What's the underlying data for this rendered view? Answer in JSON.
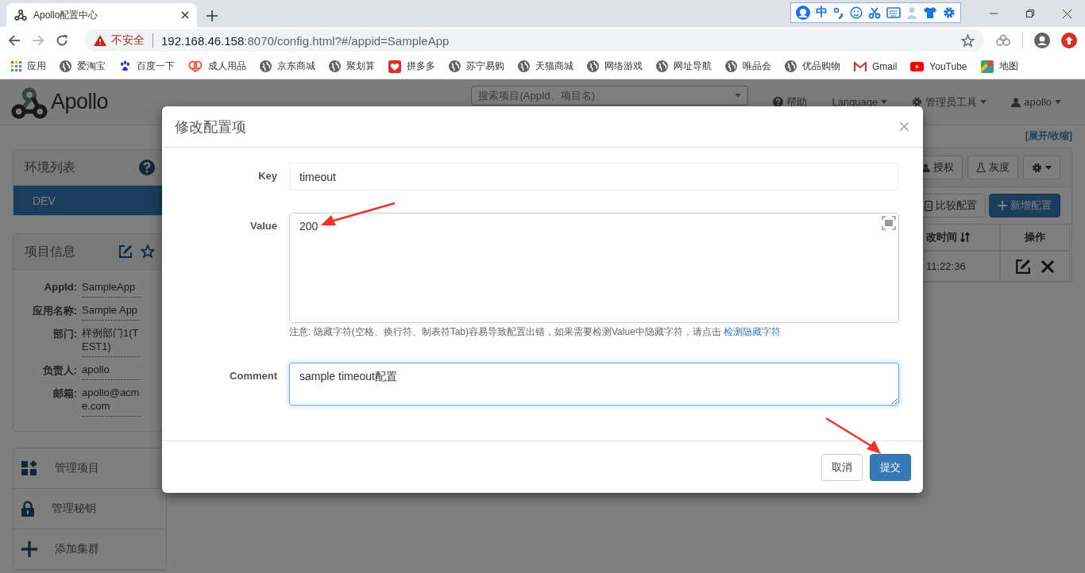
{
  "browser": {
    "tabs": [
      {
        "title": "Apollo配置中心",
        "selected": true
      }
    ],
    "ime_toolbar": {
      "mode": "中"
    },
    "address": {
      "security": "不安全",
      "host": "192.168.46.158",
      "path": ":8070/config.html?#/appid=SampleApp"
    },
    "bookmarks": [
      {
        "label": "应用",
        "kind": "apps"
      },
      {
        "label": "爱淘宝",
        "kind": "globe"
      },
      {
        "label": "百度一下",
        "kind": "paw"
      },
      {
        "label": "成人用品",
        "kind": "heart"
      },
      {
        "label": "京东商城",
        "kind": "globe"
      },
      {
        "label": "聚划算",
        "kind": "globe"
      },
      {
        "label": "拼多多",
        "kind": "gift"
      },
      {
        "label": "苏宁易购",
        "kind": "globe"
      },
      {
        "label": "天猫商城",
        "kind": "globe"
      },
      {
        "label": "网络游戏",
        "kind": "globe"
      },
      {
        "label": "网址导航",
        "kind": "globe"
      },
      {
        "label": "唯品会",
        "kind": "globe"
      },
      {
        "label": "优品购物",
        "kind": "globe"
      },
      {
        "label": "Gmail",
        "kind": "mail"
      },
      {
        "label": "YouTube",
        "kind": "video"
      },
      {
        "label": "地图",
        "kind": "map"
      }
    ]
  },
  "navbar": {
    "brand": "Apollo",
    "search": {
      "placeholder": "搜索项目(AppId、项目名)"
    },
    "links": [
      {
        "label": "帮助",
        "kind": "help"
      },
      {
        "label": "Language",
        "kind": "menu"
      },
      {
        "label": "管理员工具",
        "kind": "gear-menu"
      },
      {
        "label": "apollo",
        "kind": "user-menu"
      }
    ]
  },
  "environments": {
    "title": "环境列表",
    "items": [
      {
        "label": "DEV",
        "selected": true
      }
    ]
  },
  "project_info": {
    "title": "项目信息",
    "fields": [
      {
        "label": "AppId:",
        "value": "SampleApp"
      },
      {
        "label": "应用名称:",
        "value": "Sample App"
      },
      {
        "label": "部门:",
        "value": "样例部门1(TEST1)"
      },
      {
        "label": "负责人:",
        "value": "apollo"
      },
      {
        "label": "邮箱:",
        "value": "apollo@acme.com"
      }
    ]
  },
  "menu": [
    {
      "label": "管理项目",
      "kind": "apps"
    },
    {
      "label": "管理秘钥",
      "kind": "lock"
    },
    {
      "label": "添加集群",
      "kind": "plus"
    }
  ],
  "namespace": {
    "toggle": "[展开/收缩]",
    "actions": [
      {
        "label": "授权",
        "kind": "user"
      },
      {
        "label": "灰度",
        "kind": "flask"
      },
      {
        "kind": "gear"
      }
    ],
    "buttons": [
      {
        "label": "比较配置",
        "kind": "default"
      },
      {
        "label": "新增配置",
        "kind": "primary"
      }
    ],
    "table": {
      "columns": [
        "改时间",
        "操作"
      ],
      "rows": [
        {
          "cells": [
            "11:22:36"
          ]
        }
      ]
    }
  },
  "modal": {
    "title": "修改配置项",
    "fields": [
      {
        "label": "Key",
        "kind": "input",
        "value": "timeout",
        "focused": false
      },
      {
        "label": "Value",
        "kind": "editor",
        "value": "200",
        "focused": false,
        "note": "注意: 隐藏字符(空格、换行符、制表符Tab)容易导致配置出错，如果需要检测Value中隐藏字符，请点击",
        "note_link": "检测隐藏字符"
      },
      {
        "label": "Comment",
        "kind": "textarea",
        "value": "sample timeout配置",
        "focused": true
      }
    ],
    "buttons": [
      {
        "label": "取消",
        "kind": "default"
      },
      {
        "label": "提交",
        "kind": "primary"
      }
    ]
  }
}
